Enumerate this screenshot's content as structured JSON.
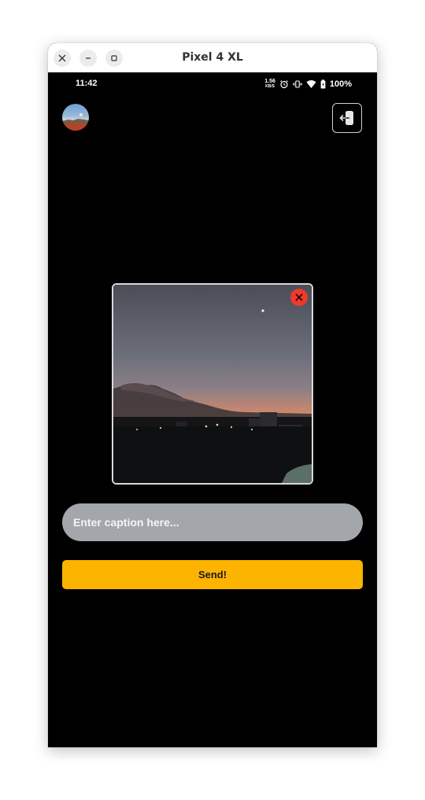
{
  "window": {
    "title": "Pixel 4 XL",
    "controls": {
      "close_icon": "close-icon",
      "minimize_icon": "minimize-icon",
      "maximize_icon": "maximize-icon"
    }
  },
  "status_bar": {
    "time": "11:42",
    "net_speed_value": "1.56",
    "net_speed_unit": "KB/S",
    "icons": [
      "alarm-icon",
      "vibrate-icon",
      "wifi-icon",
      "battery-icon"
    ],
    "battery_percent": "100%"
  },
  "header": {
    "avatar_icon": "profile-avatar",
    "exit_icon": "logout-icon"
  },
  "photo": {
    "description_icon": "sunset-photo",
    "remove_icon": "close-icon",
    "remove_color": "#f0392b"
  },
  "caption": {
    "placeholder": "Enter caption here...",
    "value": ""
  },
  "send": {
    "label": "Send!",
    "color": "#fdb400"
  }
}
